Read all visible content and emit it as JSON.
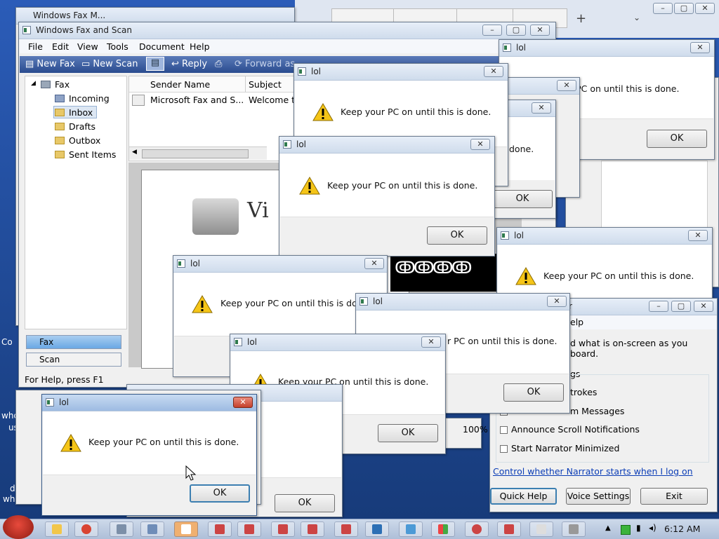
{
  "fax_app": {
    "title": "Windows Fax and Scan",
    "menu": [
      "File",
      "Edit",
      "View",
      "Tools",
      "Document",
      "Help"
    ],
    "toolbar": {
      "new_fax": "New Fax",
      "new_scan": "New Scan",
      "reply": "Reply",
      "forward": "Forward as..."
    },
    "tree": {
      "root": "Fax",
      "items": [
        "Incoming",
        "Inbox",
        "Drafts",
        "Outbox",
        "Sent Items"
      ]
    },
    "columns": {
      "sender": "Sender Name",
      "subject": "Subject"
    },
    "row": {
      "sender": "Microsoft Fax and S...",
      "subject": "Welcome t"
    },
    "nav": {
      "fax": "Fax",
      "scan": "Scan"
    },
    "status": "For Help, press F1",
    "zoom": "100%"
  },
  "behind_window_title": "Windows Fax M...",
  "dialog": {
    "title": "lol",
    "message": "Keep your PC on until this is done.",
    "ok": "OK"
  },
  "dialog_partial": {
    "message_tail": "r PC on until this is done.",
    "done": "done."
  },
  "narrator": {
    "title_fragment": "r",
    "help_menu": "elp",
    "desc_line1": "d what is on-screen as you",
    "desc_line2": "board.",
    "section": "gs",
    "options": [
      "trokes",
      "m Messages",
      "Announce Scroll Notifications",
      "Start Narrator Minimized"
    ],
    "link": "Control whether Narrator starts when I log on",
    "buttons": {
      "quick_help": "Quick Help",
      "voice_settings": "Voice Settings",
      "exit": "Exit"
    }
  },
  "taskbar": {
    "time": "6:12 AM"
  },
  "desktop_fragments": {
    "co": "Co",
    "whc": "whc",
    "us": "us",
    "d": "d",
    "wh": "wh"
  }
}
